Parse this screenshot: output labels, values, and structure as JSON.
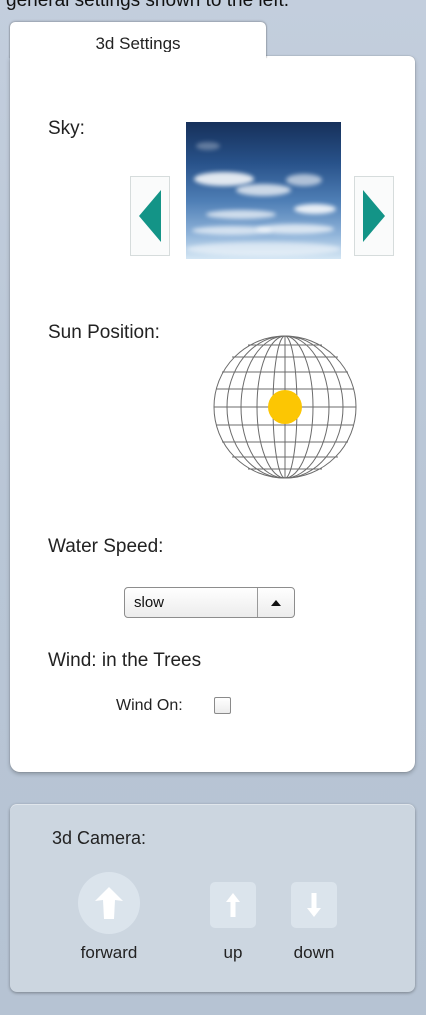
{
  "header_text": "general settings shown to the left.",
  "settings_tab": {
    "label": "3d Settings"
  },
  "sky": {
    "label": "Sky:",
    "prev_icon": "triangle-left-icon",
    "next_icon": "triangle-right-icon"
  },
  "sun": {
    "label": "Sun Position:",
    "marker_color": "#fcc603"
  },
  "water": {
    "label": "Water Speed:",
    "selected_option": "slow"
  },
  "wind": {
    "label": "Wind: in the Trees",
    "checkbox_label": "Wind On:",
    "checked": false
  },
  "camera": {
    "title": "3d Camera:",
    "forward_label": "forward",
    "up_label": "up",
    "down_label": "down"
  },
  "colors": {
    "accent_teal": "#139487",
    "sun_yellow": "#fcc603",
    "panel_bg": "#ffffff",
    "camera_panel_bg": "#ccd6e0"
  }
}
